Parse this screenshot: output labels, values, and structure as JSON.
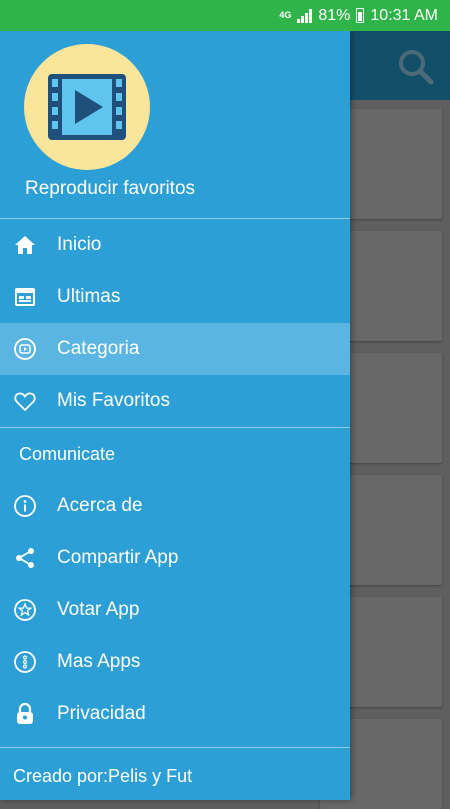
{
  "status_bar": {
    "network": "4G",
    "battery": "81%",
    "time": "10:31 AM"
  },
  "app": {
    "search_icon": "search-icon"
  },
  "drawer": {
    "header_title": "Reproducir favoritos",
    "avatar_icon": "video-play-icon",
    "items": [
      {
        "label": "Inicio",
        "icon": "home-icon"
      },
      {
        "label": "Ultimas",
        "icon": "calendar-icon"
      },
      {
        "label": "Categoria",
        "icon": "play-circle-icon",
        "selected": true
      },
      {
        "label": "Mis Favoritos",
        "icon": "heart-icon"
      }
    ],
    "section_title": "Comunicate",
    "section_items": [
      {
        "label": "Acerca de",
        "icon": "info-icon"
      },
      {
        "label": "Compartir App",
        "icon": "share-icon"
      },
      {
        "label": "Votar App",
        "icon": "star-icon"
      },
      {
        "label": "Mas Apps",
        "icon": "more-apps-icon"
      },
      {
        "label": "Privacidad",
        "icon": "lock-icon"
      }
    ],
    "footer": "Creado por:Pelis y Fut"
  },
  "colors": {
    "status_bar": "#2fb44a",
    "drawer": "#2d9fd7",
    "selected_item": "#5ab5e3",
    "toolbar": "#12506a"
  }
}
